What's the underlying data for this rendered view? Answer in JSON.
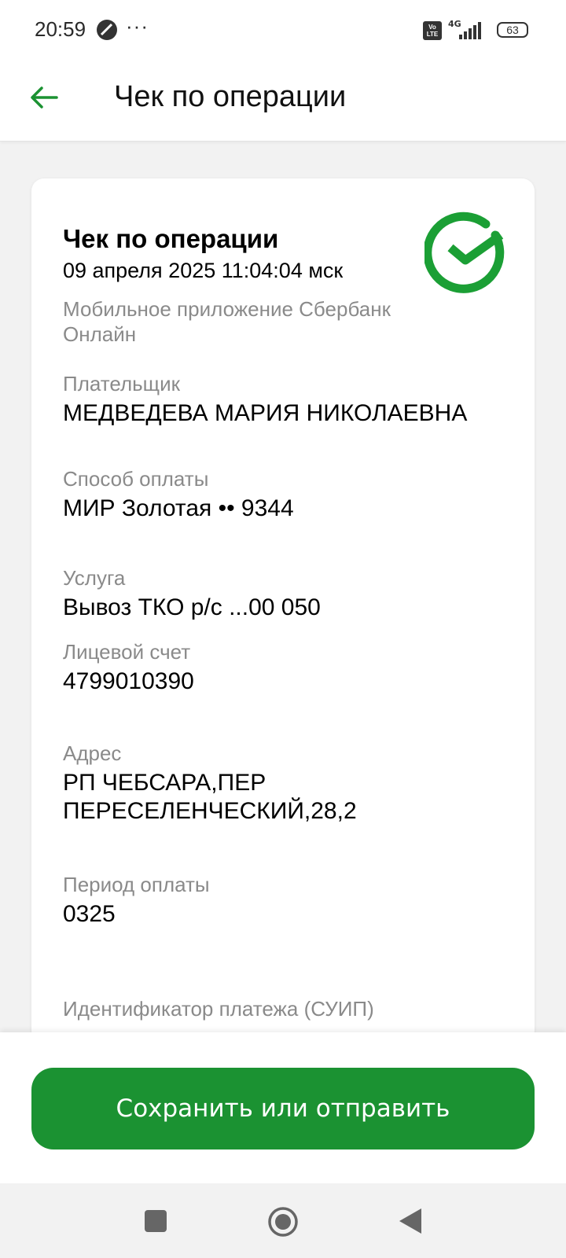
{
  "status_bar": {
    "time": "20:59",
    "dots": "···",
    "volte": "Vo LTE",
    "network": "4G",
    "battery": "63"
  },
  "header": {
    "title": "Чек по операции",
    "back_icon": "arrow-left-icon"
  },
  "receipt": {
    "title": "Чек по операции",
    "datetime": "09 апреля 2025 11:04:04 мск",
    "source": "Мобильное приложение Сбербанк Онлайн",
    "logo_icon": "sber-check-icon",
    "fields": [
      {
        "label": "Плательщик",
        "value": "МЕДВЕДЕВА МАРИЯ НИКОЛАЕВНА"
      },
      {
        "label": "Способ оплаты",
        "value": "МИР Золотая •• 9344"
      },
      {
        "label": "Услуга",
        "value": "Вывоз ТКО р/с ...00 050"
      },
      {
        "label": "Лицевой счет",
        "value": "4799010390"
      },
      {
        "label": "Адрес",
        "value": "РП ЧЕБСАРА,ПЕР ПЕРЕСЕЛЕНЧЕСКИЙ,28,2"
      },
      {
        "label": "Период оплаты",
        "value": "0325"
      },
      {
        "label": "Идентификатор платежа (СУИП)",
        "value": ""
      }
    ]
  },
  "action": {
    "save_label": "Сохранить или отправить"
  },
  "colors": {
    "brand_green": "#1b9232",
    "label_gray": "#8a8a8a"
  }
}
